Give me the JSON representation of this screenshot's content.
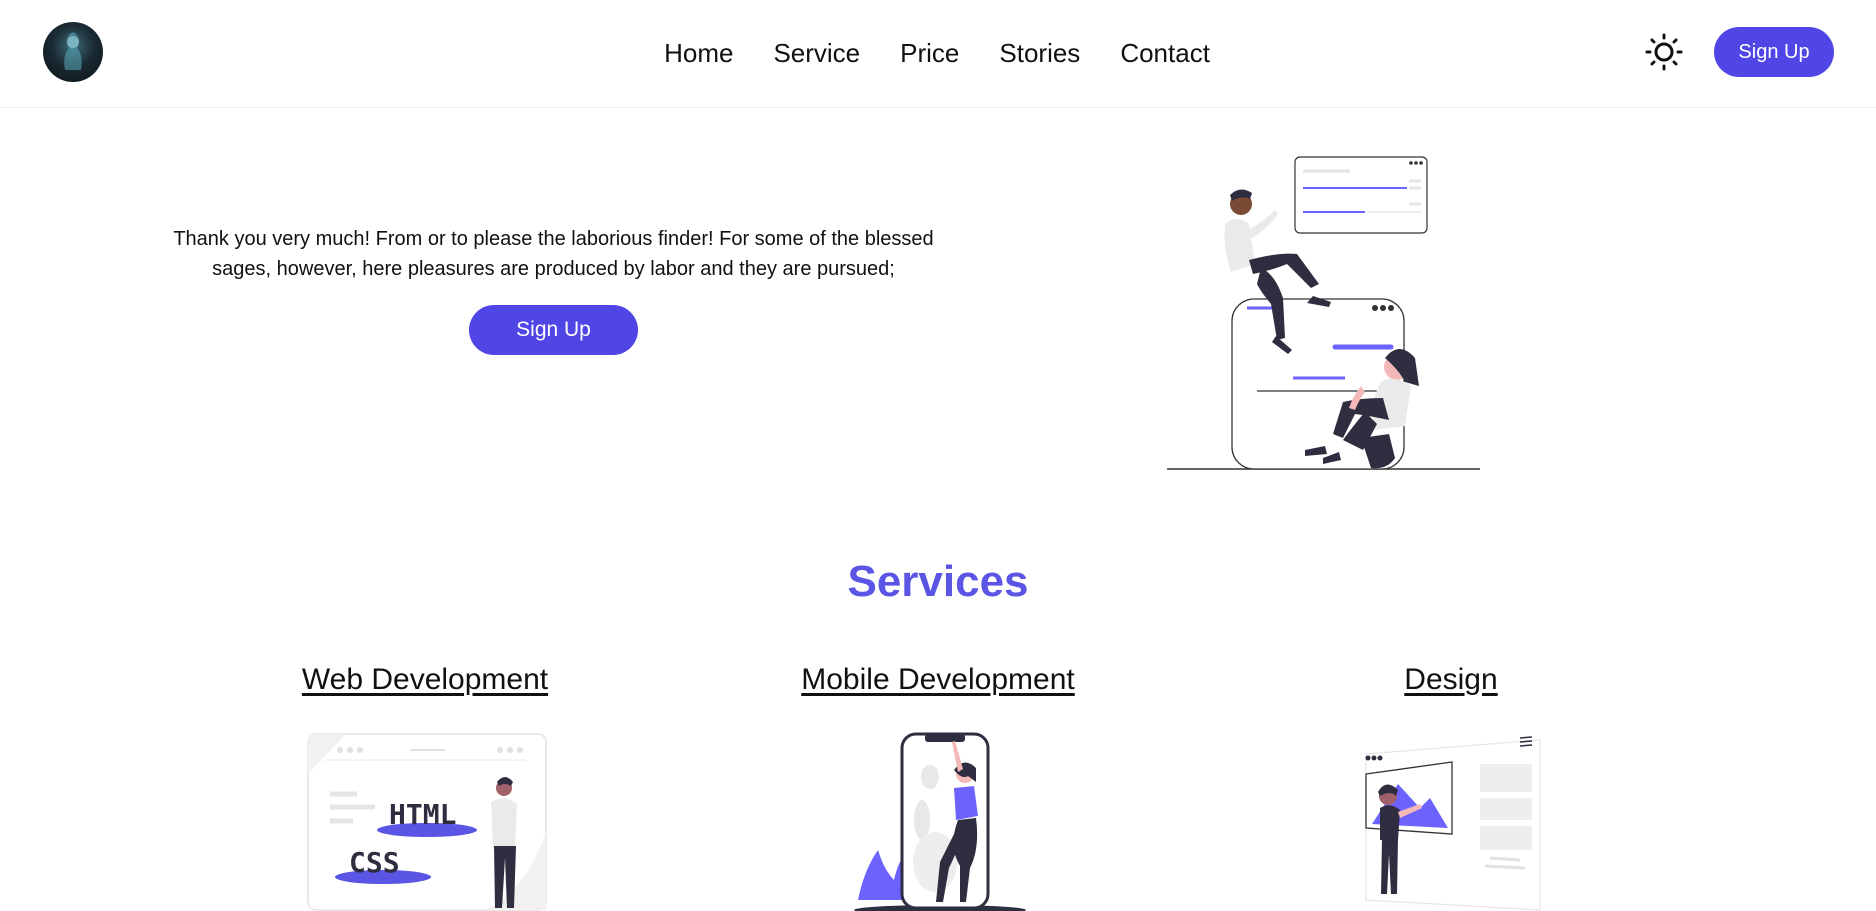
{
  "header": {
    "nav": [
      "Home",
      "Service",
      "Price",
      "Stories",
      "Contact"
    ],
    "signup_label": "Sign Up"
  },
  "hero": {
    "text": "Thank you very much! From or to please the laborious finder! For some of the blessed sages, however, here pleasures are produced by labor and they are pursued;",
    "signup_label": "Sign Up"
  },
  "services": {
    "title": "Services",
    "items": [
      {
        "title": "Web Development",
        "illustration_text": [
          "HTML",
          "CSS"
        ]
      },
      {
        "title": "Mobile Development"
      },
      {
        "title": "Design"
      }
    ]
  },
  "colors": {
    "accent": "#5046e5",
    "services_title": "#5b55e6"
  },
  "icons": {
    "theme": "sun-icon"
  }
}
